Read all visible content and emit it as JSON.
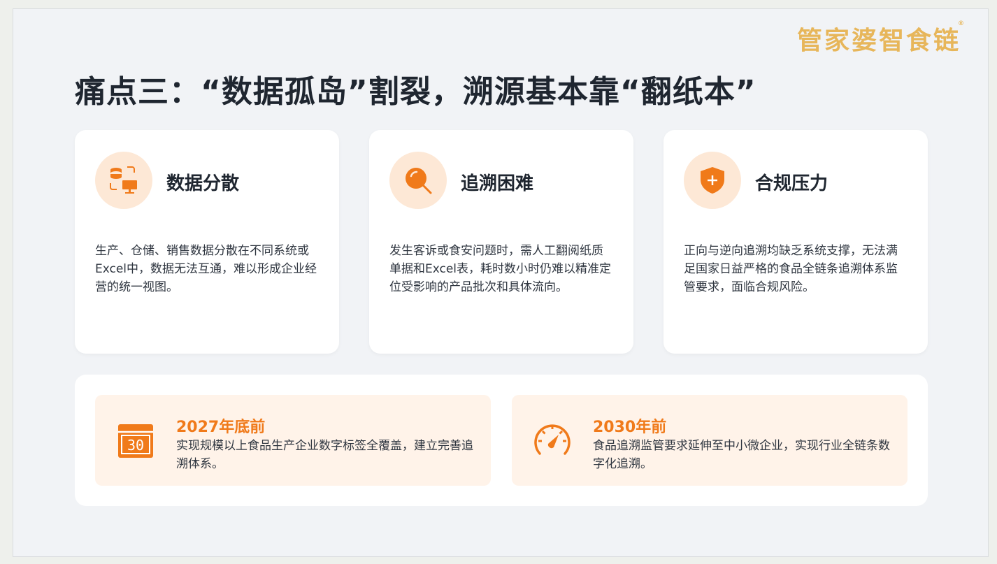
{
  "brand": {
    "logo_text": "管家婆智食链",
    "logo_mark": "®",
    "logo_color": "#e7b65a"
  },
  "title": "痛点三：“数据孤岛”割裂，溯源基本靠“翻纸本”",
  "accent_color": "#f07a1a",
  "cards": [
    {
      "icon": "database-monitor-icon",
      "title": "数据分散",
      "desc": "生产、仓储、销售数据分散在不同系统或Excel中，数据无法互通，难以形成企业经营的统一视图。"
    },
    {
      "icon": "search-icon",
      "title": "追溯困难",
      "desc": "发生客诉或食安问题时，需人工翻阅纸质单据和Excel表，耗时数小时仍难以精准定位受影响的产品批次和具体流向。"
    },
    {
      "icon": "shield-plus-icon",
      "title": "合规压力",
      "desc": "正向与逆向追溯均缺乏系统支撑，无法满足国家日益严格的食品全链条追溯体系监管要求，面临合规风险。"
    }
  ],
  "milestones": [
    {
      "icon": "calendar-icon",
      "icon_text": "30",
      "year": "2027年底前",
      "desc": "实现规模以上食品生产企业数字标签全覆盖，建立完善追溯体系。"
    },
    {
      "icon": "speedometer-icon",
      "year": "2030年前",
      "desc": "食品追溯监管要求延伸至中小微企业，实现行业全链条数字化追溯。"
    }
  ]
}
